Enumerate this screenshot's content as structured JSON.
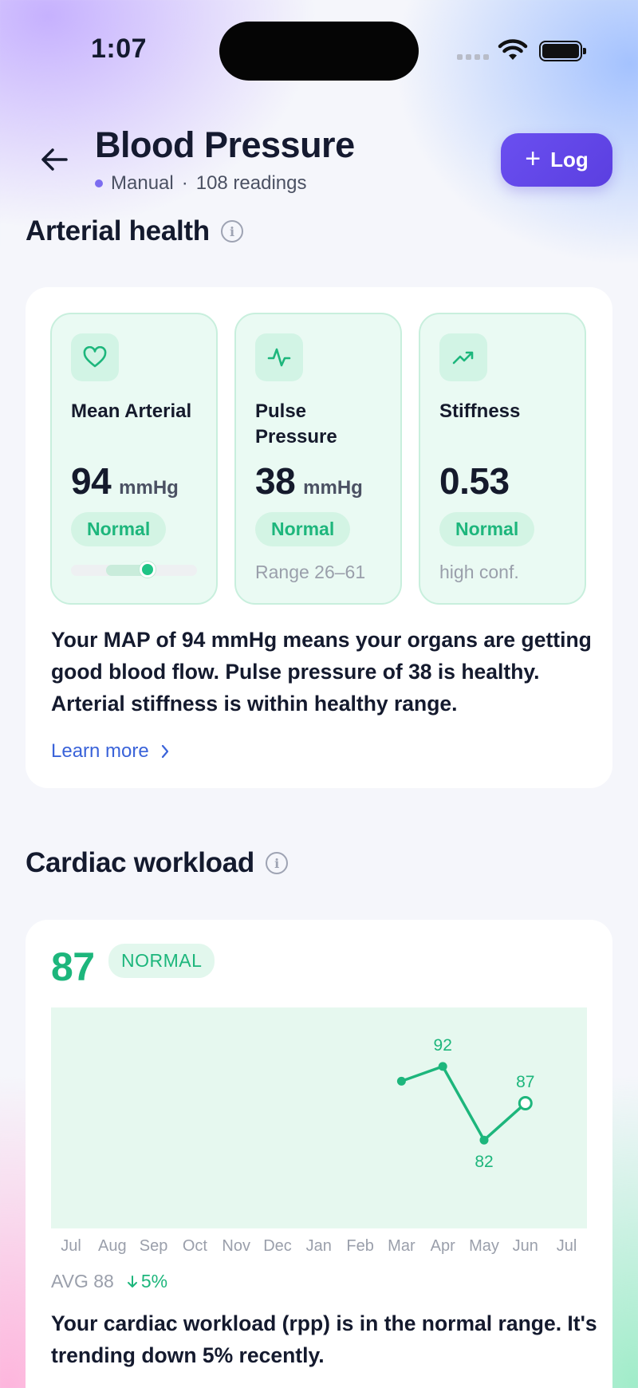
{
  "status_bar": {
    "time": "1:07"
  },
  "header": {
    "title": "Blood Pressure",
    "source": "Manual",
    "separator": "·",
    "readings": "108 readings",
    "log_label": "Log",
    "accent": "#6a4ff0"
  },
  "arterial": {
    "heading": "Arterial health",
    "metrics": [
      {
        "icon": "heart-icon",
        "name": "Mean Arterial",
        "value": "94",
        "unit": "mmHg",
        "status": "Normal",
        "range_marker_fraction": 0.62
      },
      {
        "icon": "pulse-icon",
        "name": "Pulse Pressure",
        "value": "38",
        "unit": "mmHg",
        "status": "Normal",
        "footnote": "Range 26–61"
      },
      {
        "icon": "trend-up-icon",
        "name": "Stiffness",
        "value": "0.53",
        "unit": "",
        "status": "Normal",
        "footnote": "high conf."
      }
    ],
    "summary": "Your MAP of 94 mmHg means your organs are getting good blood flow. Pulse pressure of 38 is healthy. Arterial stiffness is within healthy range.",
    "learn_more": "Learn more"
  },
  "cardiac": {
    "heading": "Cardiac workload",
    "value": "87",
    "status": "NORMAL",
    "avg": "AVG 88",
    "trend": "5%",
    "summary": "Your cardiac workload (rpp) is in the normal range. It's trending down 5% recently.",
    "colors": {
      "line": "#1db67c",
      "band": "#e6f8ef"
    }
  },
  "chart_data": {
    "type": "line",
    "categories": [
      "Jul",
      "Aug",
      "Sep",
      "Oct",
      "Nov",
      "Dec",
      "Jan",
      "Feb",
      "Mar",
      "Apr",
      "May",
      "Jun",
      "Jul"
    ],
    "values": [
      null,
      null,
      null,
      null,
      null,
      null,
      null,
      null,
      90,
      92,
      82,
      87,
      null
    ],
    "data_labels": [
      {
        "category_index": 9,
        "label": "92"
      },
      {
        "category_index": 10,
        "label": "82"
      },
      {
        "category_index": 11,
        "label": "87"
      }
    ],
    "ylim": [
      70,
      100
    ],
    "grid": false,
    "title": "",
    "xlabel": "",
    "ylabel": ""
  }
}
